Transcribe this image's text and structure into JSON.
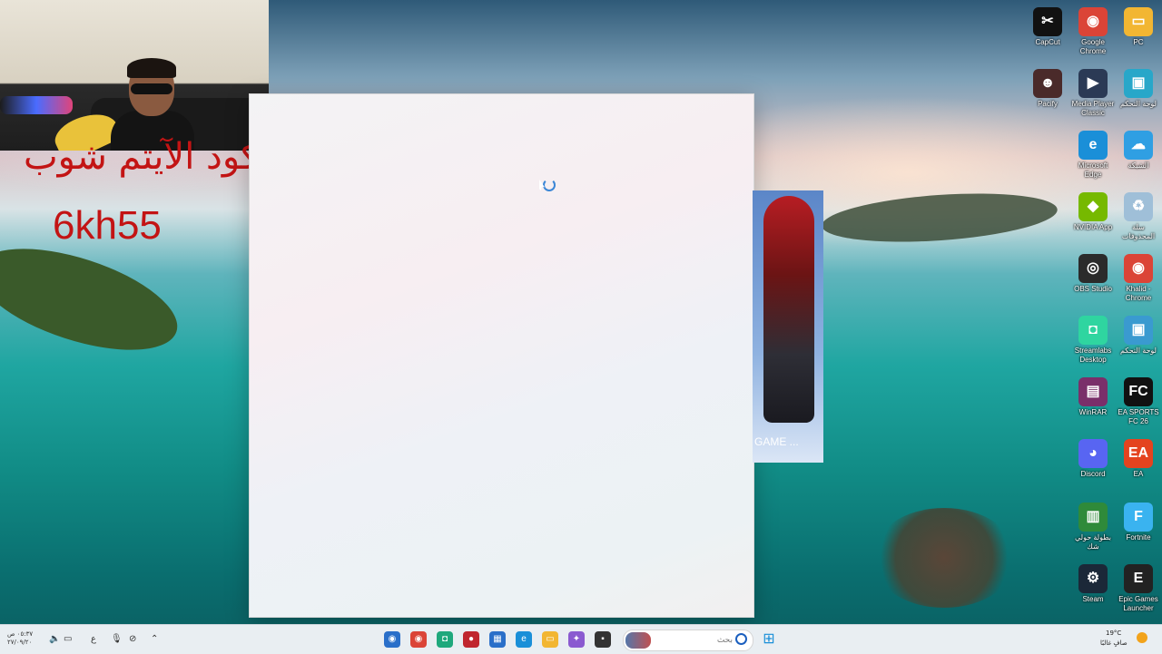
{
  "overlay": {
    "promo_text": "كود الآيتم شوب",
    "promo_code": "6kh55"
  },
  "widget": {
    "caption": "GAME ..."
  },
  "desktop_icons": [
    {
      "name": "capcut-icon",
      "label": "CapCut",
      "color": "#111111",
      "glyph": "✂"
    },
    {
      "name": "google-chrome-icon",
      "label": "Google Chrome",
      "color": "#db4437",
      "glyph": "◉"
    },
    {
      "name": "pc-icon",
      "label": "PC",
      "color": "#f2b632",
      "glyph": "▭"
    },
    {
      "name": "pacify-icon",
      "label": "Pacify",
      "color": "#4a2a2a",
      "glyph": "☻"
    },
    {
      "name": "media-player-classic-icon",
      "label": "Media Player Classic",
      "color": "#2b3a55",
      "glyph": "▶"
    },
    {
      "name": "control-panel-icon",
      "label": "لوحة التحكم",
      "color": "#28a7c9",
      "glyph": "▣"
    },
    {
      "name": "microsoft-edge-icon",
      "label": "Microsoft Edge",
      "color": "#1a8fd8",
      "glyph": "e"
    },
    {
      "name": "network-icon",
      "label": "الشبكة",
      "color": "#2f9fe3",
      "glyph": "☁"
    },
    {
      "name": "nvidia-app-icon",
      "label": "NVIDIA App",
      "color": "#76b900",
      "glyph": "◆"
    },
    {
      "name": "recycle-bin-icon",
      "label": "سلة المحذوفات",
      "color": "#9fbfd8",
      "glyph": "♻"
    },
    {
      "name": "obs-studio-icon",
      "label": "OBS Studio",
      "color": "#2b2b2b",
      "glyph": "◎"
    },
    {
      "name": "chrome-khalid-icon",
      "label": "Khalid - Chrome",
      "color": "#db4437",
      "glyph": "◉"
    },
    {
      "name": "streamlabs-icon",
      "label": "Streamlabs Desktop",
      "color": "#2fd5a0",
      "glyph": "◘"
    },
    {
      "name": "control-panel-2-icon",
      "label": "لوحة التحكم",
      "color": "#3a9ad0",
      "glyph": "▣"
    },
    {
      "name": "winrar-icon",
      "label": "WinRAR",
      "color": "#7a2f6a",
      "glyph": "▤"
    },
    {
      "name": "ea-sports-fc-icon",
      "label": "EA SPORTS FC 26",
      "color": "#111111",
      "glyph": "FC"
    },
    {
      "name": "discord-icon",
      "label": "Discord",
      "color": "#5865f2",
      "glyph": "◕"
    },
    {
      "name": "ea-icon",
      "label": "EA",
      "color": "#e4431f",
      "glyph": "EA"
    },
    {
      "name": "tournament-icon",
      "label": "بطولة حولي شك",
      "color": "#2f8a3a",
      "glyph": "▥"
    },
    {
      "name": "fortnite-icon",
      "label": "Fortnite",
      "color": "#3ab3f0",
      "glyph": "F"
    },
    {
      "name": "steam-icon",
      "label": "Steam",
      "color": "#1b2838",
      "glyph": "⚙"
    },
    {
      "name": "epic-games-icon",
      "label": "Epic Games Launcher",
      "color": "#222222",
      "glyph": "E"
    }
  ],
  "taskbar": {
    "search_placeholder": "بحث",
    "clock": "٠٥:٣٧ ص ٢٧/٠٩/٢٠",
    "language": "ع",
    "weather_temp": "19°C",
    "weather_condition": "صافٍ غالبًا",
    "apps": [
      {
        "name": "taskbar-app-blue-icon",
        "color": "#2a6fc9",
        "glyph": "◉"
      },
      {
        "name": "taskbar-chrome-icon",
        "color": "#db4437",
        "glyph": "◉"
      },
      {
        "name": "taskbar-streamlabs-icon",
        "color": "#1fa87c",
        "glyph": "◘"
      },
      {
        "name": "taskbar-red-app-icon",
        "color": "#c0262e",
        "glyph": "●"
      },
      {
        "name": "taskbar-store-icon",
        "color": "#2a6fc9",
        "glyph": "▦"
      },
      {
        "name": "taskbar-edge-icon",
        "color": "#1a8fd8",
        "glyph": "e"
      },
      {
        "name": "taskbar-file-explorer-icon",
        "color": "#f2b632",
        "glyph": "▭"
      },
      {
        "name": "taskbar-colorful-app-icon",
        "color": "#8a5ad0",
        "glyph": "✦"
      },
      {
        "name": "taskbar-terminal-icon",
        "color": "#333333",
        "glyph": "▪"
      }
    ]
  }
}
